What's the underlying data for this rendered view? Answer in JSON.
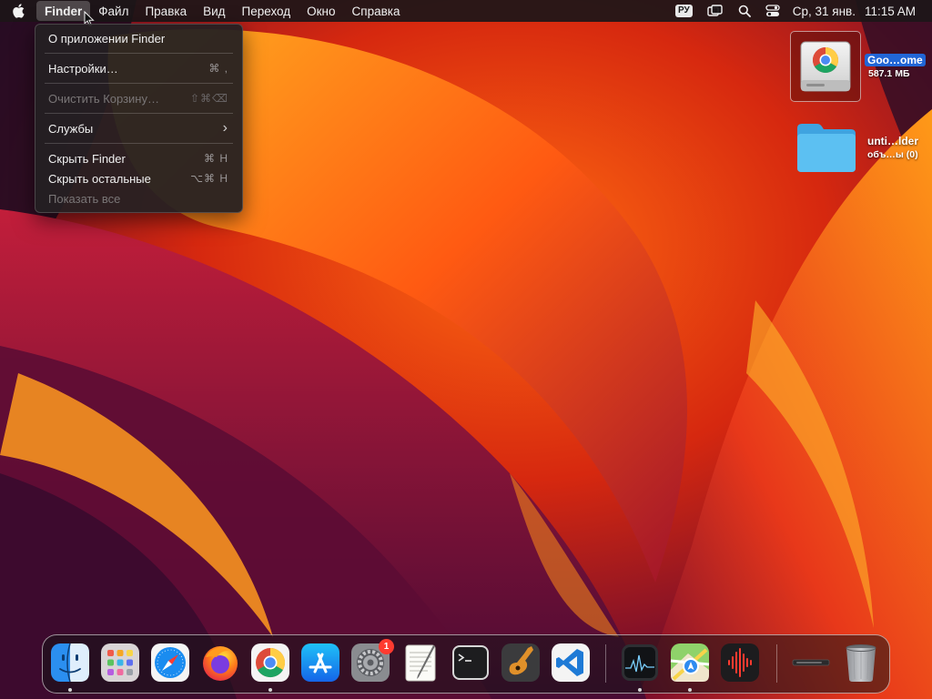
{
  "menubar": {
    "app_menus": [
      "Finder",
      "Файл",
      "Правка",
      "Вид",
      "Переход",
      "Окно",
      "Справка"
    ],
    "active_menu": "Finder",
    "input_language": "РУ",
    "date": "Ср, 31 янв.",
    "time": "11:15 AM"
  },
  "finder_menu": {
    "about": "О приложении Finder",
    "settings": "Настройки…",
    "settings_shortcut": "⌘ ,",
    "empty_trash": "Очистить Корзину…",
    "empty_trash_shortcut": "⇧⌘⌫",
    "services": "Службы",
    "services_arrow": "›",
    "hide_finder": "Скрыть Finder",
    "hide_finder_shortcut": "⌘ H",
    "hide_others": "Скрыть остальные",
    "hide_others_shortcut": "⌥⌘ H",
    "show_all": "Показать все"
  },
  "desktop": {
    "items": [
      {
        "name": "Goo…ome",
        "subtitle": "587.1 МБ",
        "icon": "chrome-disk-image-icon",
        "selected": true
      },
      {
        "name": "unti…lder",
        "subtitle": "объ…ы (0)",
        "icon": "folder-icon",
        "selected": false
      }
    ]
  },
  "dock": {
    "apps": [
      {
        "name": "Finder",
        "icon": "finder-icon",
        "running": true
      },
      {
        "name": "Launchpad",
        "icon": "launchpad-icon",
        "running": false
      },
      {
        "name": "Safari",
        "icon": "safari-icon",
        "running": false
      },
      {
        "name": "Firefox",
        "icon": "firefox-icon",
        "running": false
      },
      {
        "name": "Google Chrome",
        "icon": "chrome-icon",
        "running": true
      },
      {
        "name": "App Store",
        "icon": "app-store-icon",
        "running": false
      },
      {
        "name": "System Settings",
        "icon": "system-settings-icon",
        "running": false,
        "badge": "1"
      },
      {
        "name": "TextEdit",
        "icon": "textedit-icon",
        "running": false
      },
      {
        "name": "Terminal",
        "icon": "terminal-icon",
        "running": false
      },
      {
        "name": "GarageBand",
        "icon": "garageband-icon",
        "running": false
      },
      {
        "name": "Visual Studio Code",
        "icon": "vscode-icon",
        "running": false
      },
      {
        "name": "Activity Monitor",
        "icon": "activity-monitor-icon",
        "running": true
      },
      {
        "name": "Maps",
        "icon": "maps-icon",
        "running": true
      },
      {
        "name": "Voice Memos",
        "icon": "voice-memos-icon",
        "running": false
      },
      {
        "name": "Downloads stack",
        "icon": "stack-icon",
        "running": false
      },
      {
        "name": "Trash",
        "icon": "trash-icon",
        "running": false
      }
    ]
  },
  "colors": {
    "selection_blue": "#2166d6",
    "badge_red": "#ff3b30",
    "folder_blue": "#4fb6ee"
  }
}
